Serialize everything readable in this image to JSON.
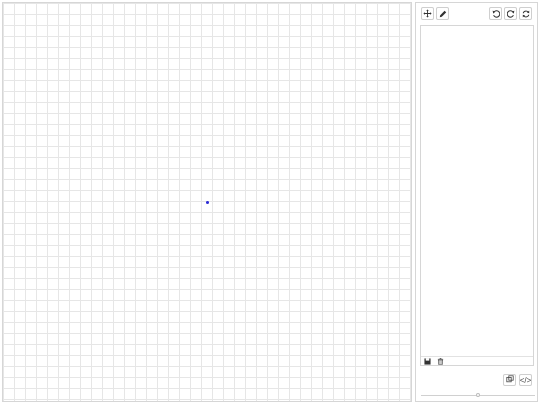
{
  "canvas": {
    "point_color": "#2b2bd6"
  },
  "toolbar": {
    "left_tools": [
      {
        "icon": "move-icon"
      },
      {
        "icon": "pencil-icon"
      }
    ],
    "history": [
      {
        "icon": "undo-icon"
      },
      {
        "icon": "redo-icon"
      },
      {
        "icon": "refresh-icon"
      }
    ]
  },
  "list_footer": {
    "icons": [
      "save-icon",
      "trash-icon"
    ]
  },
  "bottom_actions": {
    "copy_icon": "copy-icon",
    "code_label": "</>"
  },
  "slider": {
    "level": 0.5
  }
}
